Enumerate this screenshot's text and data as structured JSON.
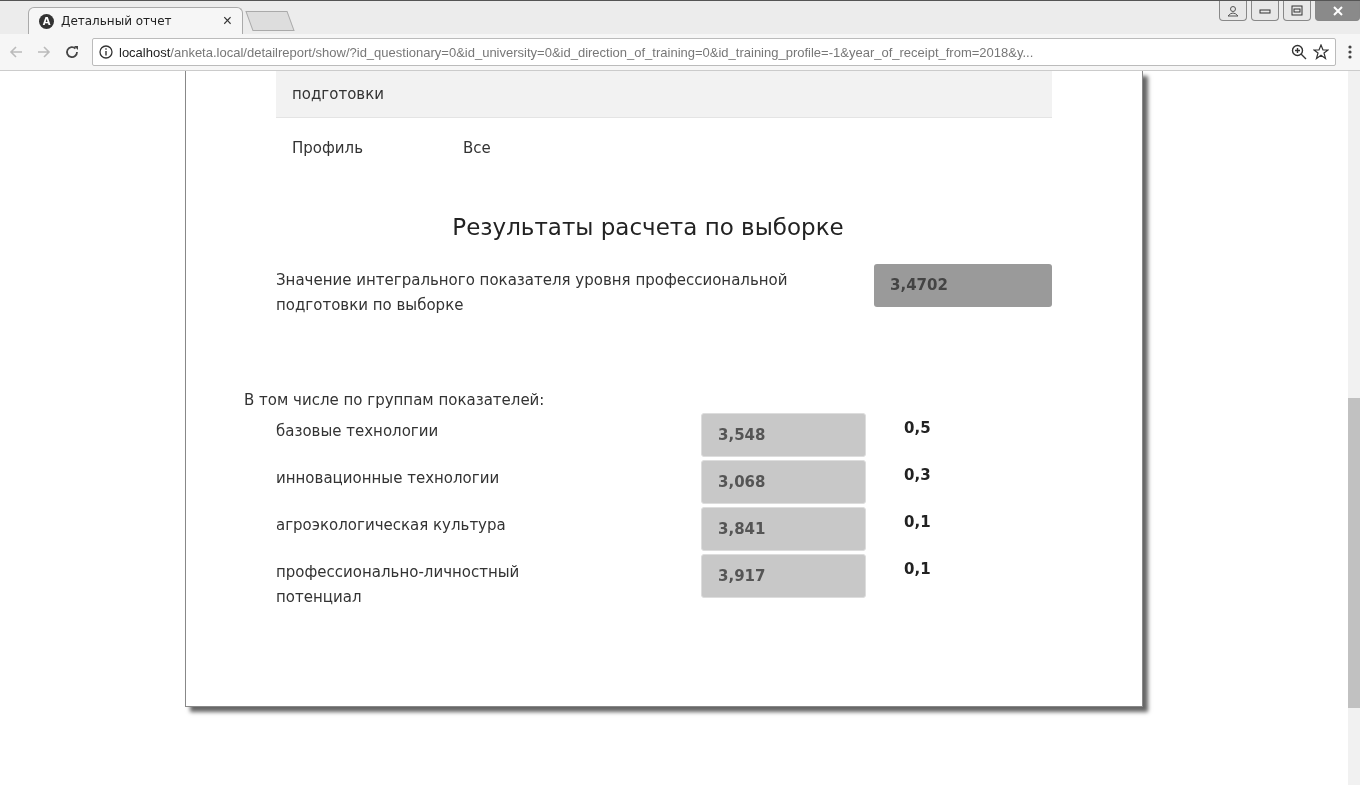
{
  "browser": {
    "tab": {
      "favicon_letter": "A",
      "title": "Детальный отчет",
      "close": "×",
      "selected": true
    },
    "address": {
      "host": "localhost",
      "path": "/anketa.local/detailreport/show/?id_questionary=0&id_university=0&id_direction_of_training=0&id_training_profile=-1&year_of_receipt_from=2018&y..."
    }
  },
  "filters": [
    {
      "value": "подготовки",
      "shaded": true
    },
    {
      "label": "Профиль",
      "value": "Все",
      "shaded": false
    }
  ],
  "results": {
    "title": "Результаты расчета по выборке",
    "integral": {
      "label": "Значение интегрального показателя уровня профессиональной подготовки по выборке",
      "value": "3,4702"
    },
    "groups_heading": "В том числе по группам показателей:",
    "groups": [
      {
        "name": "базовые технологии",
        "value": "3,548",
        "weight": "0,5"
      },
      {
        "name": "инновационные технологии",
        "value": "3,068",
        "weight": "0,3"
      },
      {
        "name": "агроэкологическая культура",
        "value": "3,841",
        "weight": "0,1"
      },
      {
        "name": "профессионально-личностный потенциал",
        "value": "3,917",
        "weight": "0,1"
      }
    ]
  }
}
